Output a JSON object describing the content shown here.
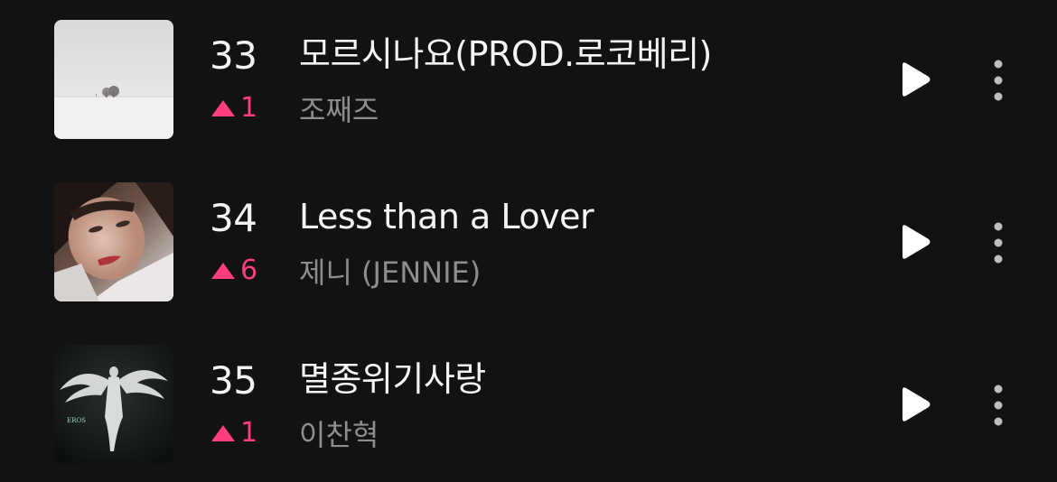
{
  "chart": {
    "items": [
      {
        "rank": "33",
        "change_value": "1",
        "change_direction": "up",
        "title": "모르시나요(PROD.로코베리)",
        "artist": "조째즈",
        "cover_icon": "snowy-landscape-cover"
      },
      {
        "rank": "34",
        "change_value": "6",
        "change_direction": "up",
        "title": "Less than a Lover",
        "artist": "제니 (JENNIE)",
        "cover_icon": "portrait-cover"
      },
      {
        "rank": "35",
        "change_value": "1",
        "change_direction": "up",
        "title": "멸종위기사랑",
        "artist": "이찬혁",
        "cover_icon": "winged-figure-cover",
        "cover_text": "EROS"
      }
    ]
  },
  "colors": {
    "background": "#121212",
    "rank_up": "#ff3d7f",
    "title": "#f4f4f4",
    "artist": "#8e8e8e"
  },
  "icons": {
    "play": "play-icon",
    "more": "more-vertical-icon"
  }
}
